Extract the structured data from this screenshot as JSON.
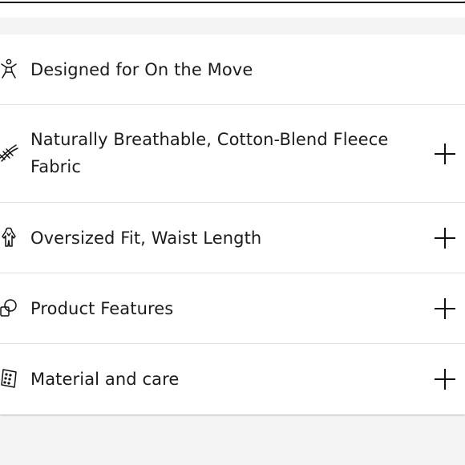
{
  "features": [
    {
      "icon": "person-arms-raised-icon",
      "label": "Designed for On the Move",
      "expandable": false
    },
    {
      "icon": "fabric-weave-icon",
      "label": "Naturally Breathable, Cotton-Blend Fleece Fabric",
      "expandable": true
    },
    {
      "icon": "hoodie-fit-icon",
      "label": "Oversized Fit, Waist Length",
      "expandable": true
    },
    {
      "icon": "product-features-icon",
      "label": "Product Features",
      "expandable": true
    },
    {
      "icon": "care-label-icon",
      "label": "Material and care",
      "expandable": true
    }
  ]
}
